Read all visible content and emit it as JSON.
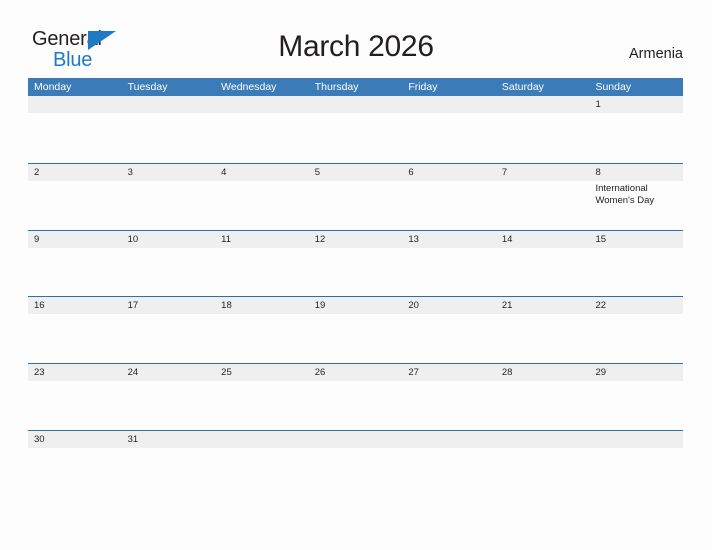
{
  "brand": {
    "name_part1": "General",
    "name_part2": "Blue",
    "flag_color": "#1f7ac4",
    "text_color": "#231f20"
  },
  "header": {
    "title": "March 2026",
    "country": "Armenia"
  },
  "theme": {
    "header_blue": "#3b7cb8",
    "rule_blue": "#2f6ea8",
    "band_gray": "#efefef",
    "page_background": "#fdfdfd",
    "text": "#231f20"
  },
  "weekdays": [
    {
      "label": "Monday"
    },
    {
      "label": "Tuesday"
    },
    {
      "label": "Wednesday"
    },
    {
      "label": "Thursday"
    },
    {
      "label": "Friday"
    },
    {
      "label": "Saturday"
    },
    {
      "label": "Sunday"
    }
  ],
  "weeks": [
    [
      {
        "date": ""
      },
      {
        "date": ""
      },
      {
        "date": ""
      },
      {
        "date": ""
      },
      {
        "date": ""
      },
      {
        "date": ""
      },
      {
        "date": "1"
      }
    ],
    [
      {
        "date": "2"
      },
      {
        "date": "3"
      },
      {
        "date": "4"
      },
      {
        "date": "5"
      },
      {
        "date": "6"
      },
      {
        "date": "7"
      },
      {
        "date": "8",
        "event": "International Women's Day"
      }
    ],
    [
      {
        "date": "9"
      },
      {
        "date": "10"
      },
      {
        "date": "11"
      },
      {
        "date": "12"
      },
      {
        "date": "13"
      },
      {
        "date": "14"
      },
      {
        "date": "15"
      }
    ],
    [
      {
        "date": "16"
      },
      {
        "date": "17"
      },
      {
        "date": "18"
      },
      {
        "date": "19"
      },
      {
        "date": "20"
      },
      {
        "date": "21"
      },
      {
        "date": "22"
      }
    ],
    [
      {
        "date": "23"
      },
      {
        "date": "24"
      },
      {
        "date": "25"
      },
      {
        "date": "26"
      },
      {
        "date": "27"
      },
      {
        "date": "28"
      },
      {
        "date": "29"
      }
    ],
    [
      {
        "date": "30"
      },
      {
        "date": "31"
      },
      {
        "date": ""
      },
      {
        "date": ""
      },
      {
        "date": ""
      },
      {
        "date": ""
      },
      {
        "date": ""
      }
    ]
  ]
}
